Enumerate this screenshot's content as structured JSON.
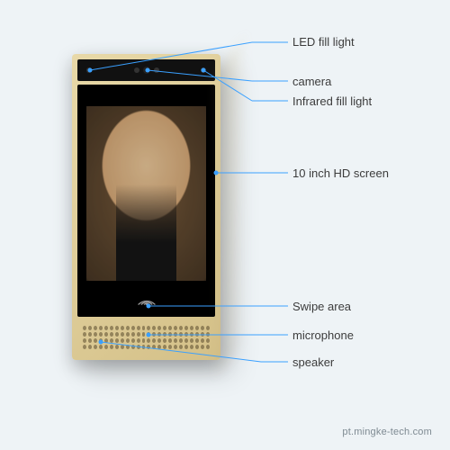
{
  "labels": {
    "led_fill_light": "LED fill light",
    "camera": "camera",
    "infrared_fill_light": "Infrared fill light",
    "screen_10in": "10 inch HD screen",
    "swipe_area": "Swipe area",
    "microphone": "microphone",
    "speaker": "speaker"
  },
  "watermark": "pt.mingke-tech.com"
}
